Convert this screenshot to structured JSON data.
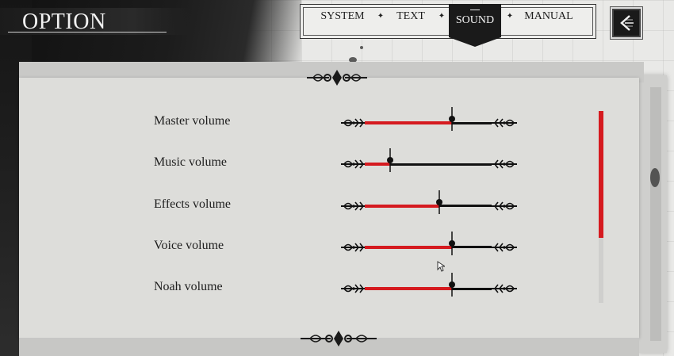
{
  "screen": {
    "title": "OPTION"
  },
  "tabs": [
    {
      "label": "SYSTEM",
      "active": false
    },
    {
      "label": "TEXT",
      "active": false
    },
    {
      "label": "SOUND",
      "active": true
    },
    {
      "label": "MANUAL",
      "active": false
    }
  ],
  "back_button": {
    "icon": "back-arrow-icon"
  },
  "sliders": [
    {
      "label": "Master volume",
      "value": 0.69
    },
    {
      "label": "Music volume",
      "value": 0.2
    },
    {
      "label": "Effects volume",
      "value": 0.59
    },
    {
      "label": "Voice volume",
      "value": 0.69
    },
    {
      "label": "Noah volume",
      "value": 0.69
    }
  ],
  "scrollbar": {
    "position": 0.0,
    "visible_fraction": 0.66
  },
  "colors": {
    "accent_red": "#d51a1f",
    "ink": "#111111",
    "panel": "#ddddda",
    "tab_active_bg": "#1a1a1a"
  }
}
